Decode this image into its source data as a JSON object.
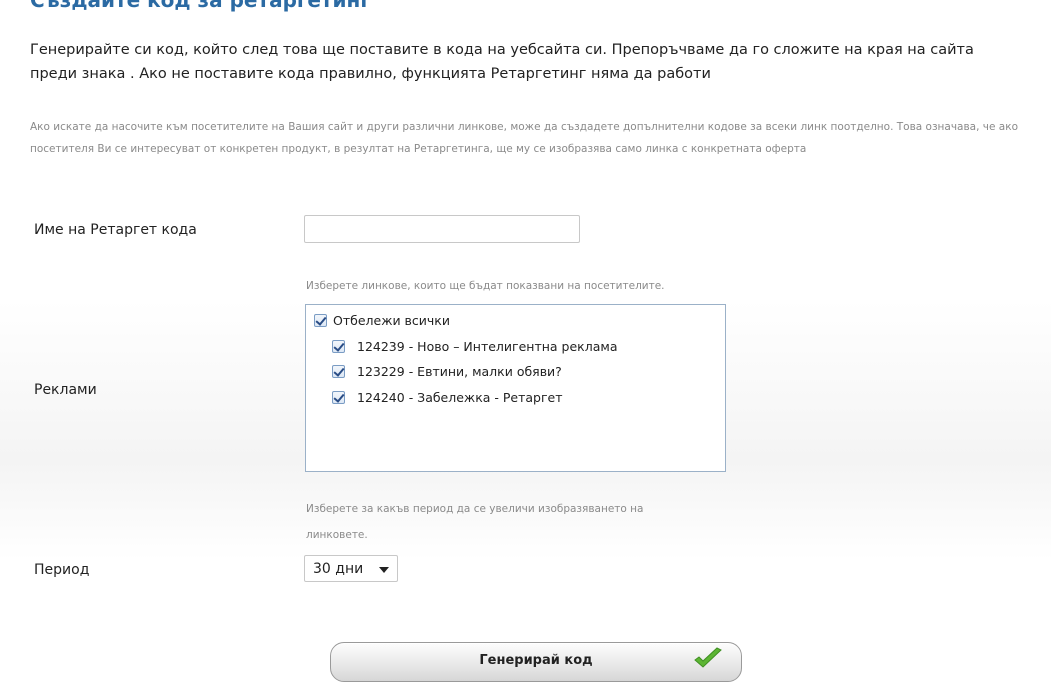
{
  "page": {
    "top_title": "Създайте код за ретаргетинг",
    "intro": "Генерирайте си код, който след това ще поставите в кода на уебсайта си. Препоръчваме да го сложите на края на сайта преди знака . Ако не поставите кода правилно, функцията Ретаргетинг няма да работи",
    "info": "Ако искате да насочите към посетителите на Вашия сайт и други различни линкове, може да създадете допълнителни кодове за всеки линк поотделно. Това означава, че ако посетителя Ви се интересуват от конкретен продукт, в резултат на Ретаргетинга, ще му се изобразява само линка с конкретната оферта"
  },
  "form": {
    "name_label": "Име на Ретаргет кода",
    "name_value": "",
    "ads_hint": "Изберете линкове, които ще бъдат показвани на посетителите.",
    "ads_label": "Реклами",
    "select_all_label": "Отбележи всички",
    "select_all_checked": true,
    "ads": [
      {
        "label": "124239 - Ново – Интелигентна реклама",
        "checked": true
      },
      {
        "label": "123229 - Евтини, малки обяви?",
        "checked": true
      },
      {
        "label": "124240 - Забележка - Ретаргет",
        "checked": true
      }
    ],
    "period_hint_line1": "Изберете за какъв период да се увеличи изобразяването на",
    "period_hint_line2": "линковете.",
    "period_label": "Период",
    "period_value": "30 дни",
    "generate_label": "Генерирай код"
  },
  "icons": {
    "select_caret": "chevron-down-icon",
    "generate_icon": "check-icon"
  },
  "colors": {
    "title_blue": "#2b6aa3",
    "hint_gray": "#8a8a8a",
    "check_green": "#5cb533"
  }
}
